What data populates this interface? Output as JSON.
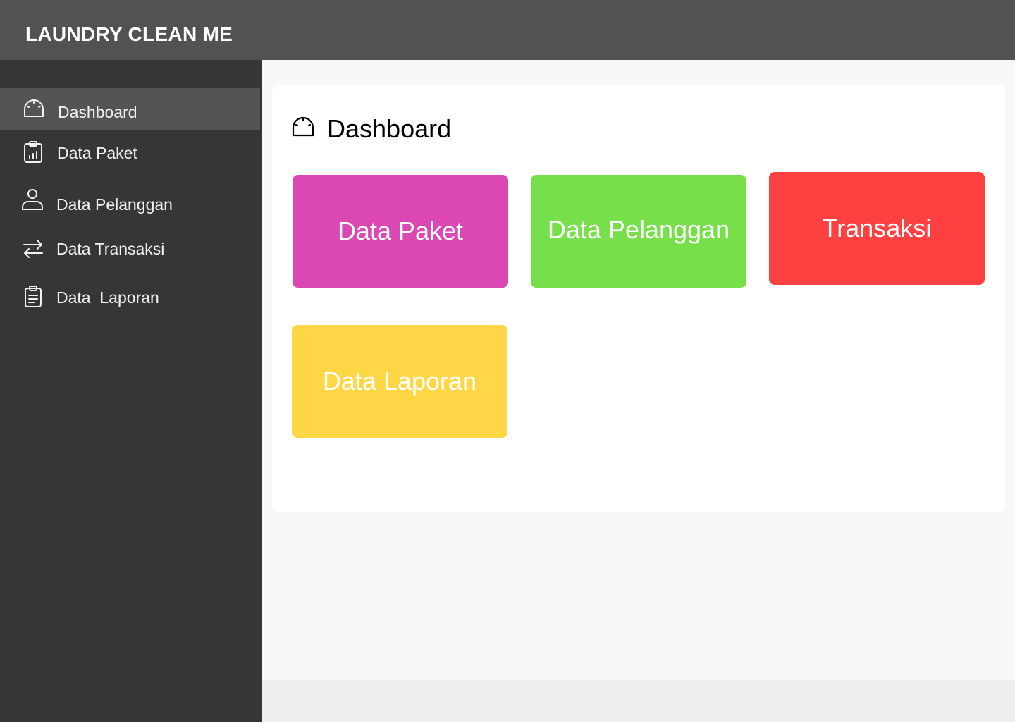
{
  "app": {
    "title": "LAUNDRY CLEAN ME"
  },
  "sidebar": {
    "items": [
      {
        "label": "Dashboard",
        "icon": "dashboard-icon",
        "active": true
      },
      {
        "label": "Data Paket",
        "icon": "clipboard-chart-icon",
        "active": false
      },
      {
        "label": "Data Pelanggan",
        "icon": "user-icon",
        "active": false
      },
      {
        "label": "Data Transaksi",
        "icon": "transfer-arrows-icon",
        "active": false
      },
      {
        "label": "Data  Laporan",
        "icon": "clipboard-list-icon",
        "active": false
      }
    ]
  },
  "main": {
    "title": "Dashboard",
    "title_icon": "dashboard-icon",
    "cards": [
      {
        "label": "Data Paket",
        "color": "#db48b4"
      },
      {
        "label": "Data Pelanggan",
        "color": "#77df4a"
      },
      {
        "label": "Transaksi",
        "color": "#ff4040"
      },
      {
        "label": "Data Laporan",
        "color": "#ffd746"
      }
    ]
  },
  "colors": {
    "topbar": "#525252",
    "sidebar": "#363636",
    "sidebar_active": "#545454",
    "content_bg": "#f8f8f8",
    "panel": "#ffffff"
  }
}
